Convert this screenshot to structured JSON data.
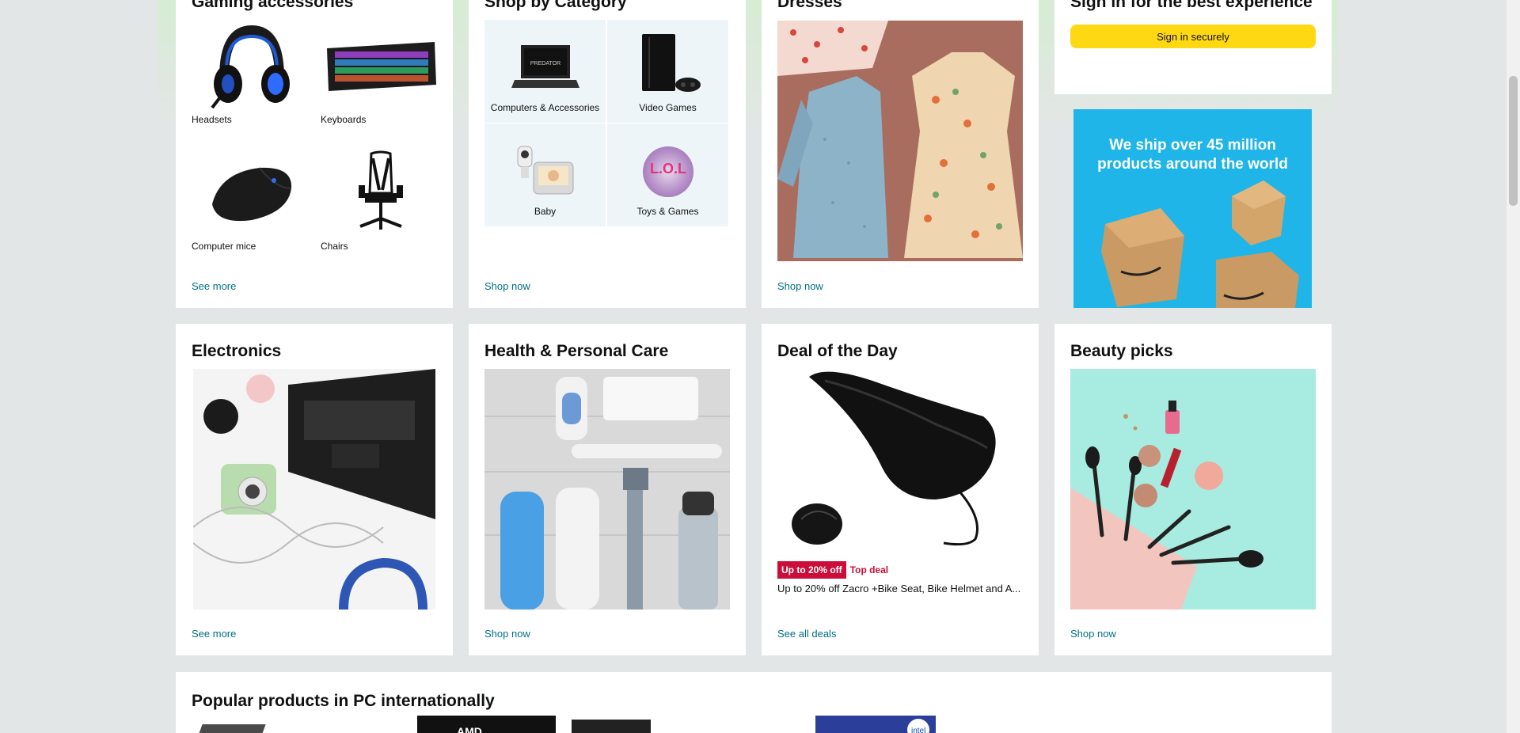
{
  "gaming": {
    "title": "Gaming accessories",
    "items": [
      {
        "label": "Headsets"
      },
      {
        "label": "Keyboards"
      },
      {
        "label": "Computer mice"
      },
      {
        "label": "Chairs"
      }
    ],
    "link": "See more"
  },
  "category": {
    "title": "Shop by Category",
    "items": [
      {
        "label": "Computers & Accessories"
      },
      {
        "label": "Video Games"
      },
      {
        "label": "Baby"
      },
      {
        "label": "Toys & Games"
      }
    ],
    "link": "Shop now"
  },
  "dresses": {
    "title": "Dresses",
    "link": "Shop now"
  },
  "signin": {
    "title": "Sign in for the best experience",
    "button": "Sign in securely"
  },
  "ship_ad": {
    "text": "We ship over 45 million products around the world"
  },
  "electronics": {
    "title": "Electronics",
    "link": "See more"
  },
  "health": {
    "title": "Health & Personal Care",
    "link": "Shop now"
  },
  "deal": {
    "title": "Deal of the Day",
    "badge": "Up to 20% off",
    "tag": "Top deal",
    "desc": "Up to 20% off Zacro +Bike Seat, Bike Helmet and A...",
    "link": "See all deals"
  },
  "beauty": {
    "title": "Beauty picks",
    "link": "Shop now"
  },
  "popular": {
    "title": "Popular products in PC internationally"
  },
  "colors": {
    "link": "#007185",
    "button": "#ffd814",
    "deal_red": "#cc0c39",
    "ad_blue": "#1fb5e8"
  }
}
